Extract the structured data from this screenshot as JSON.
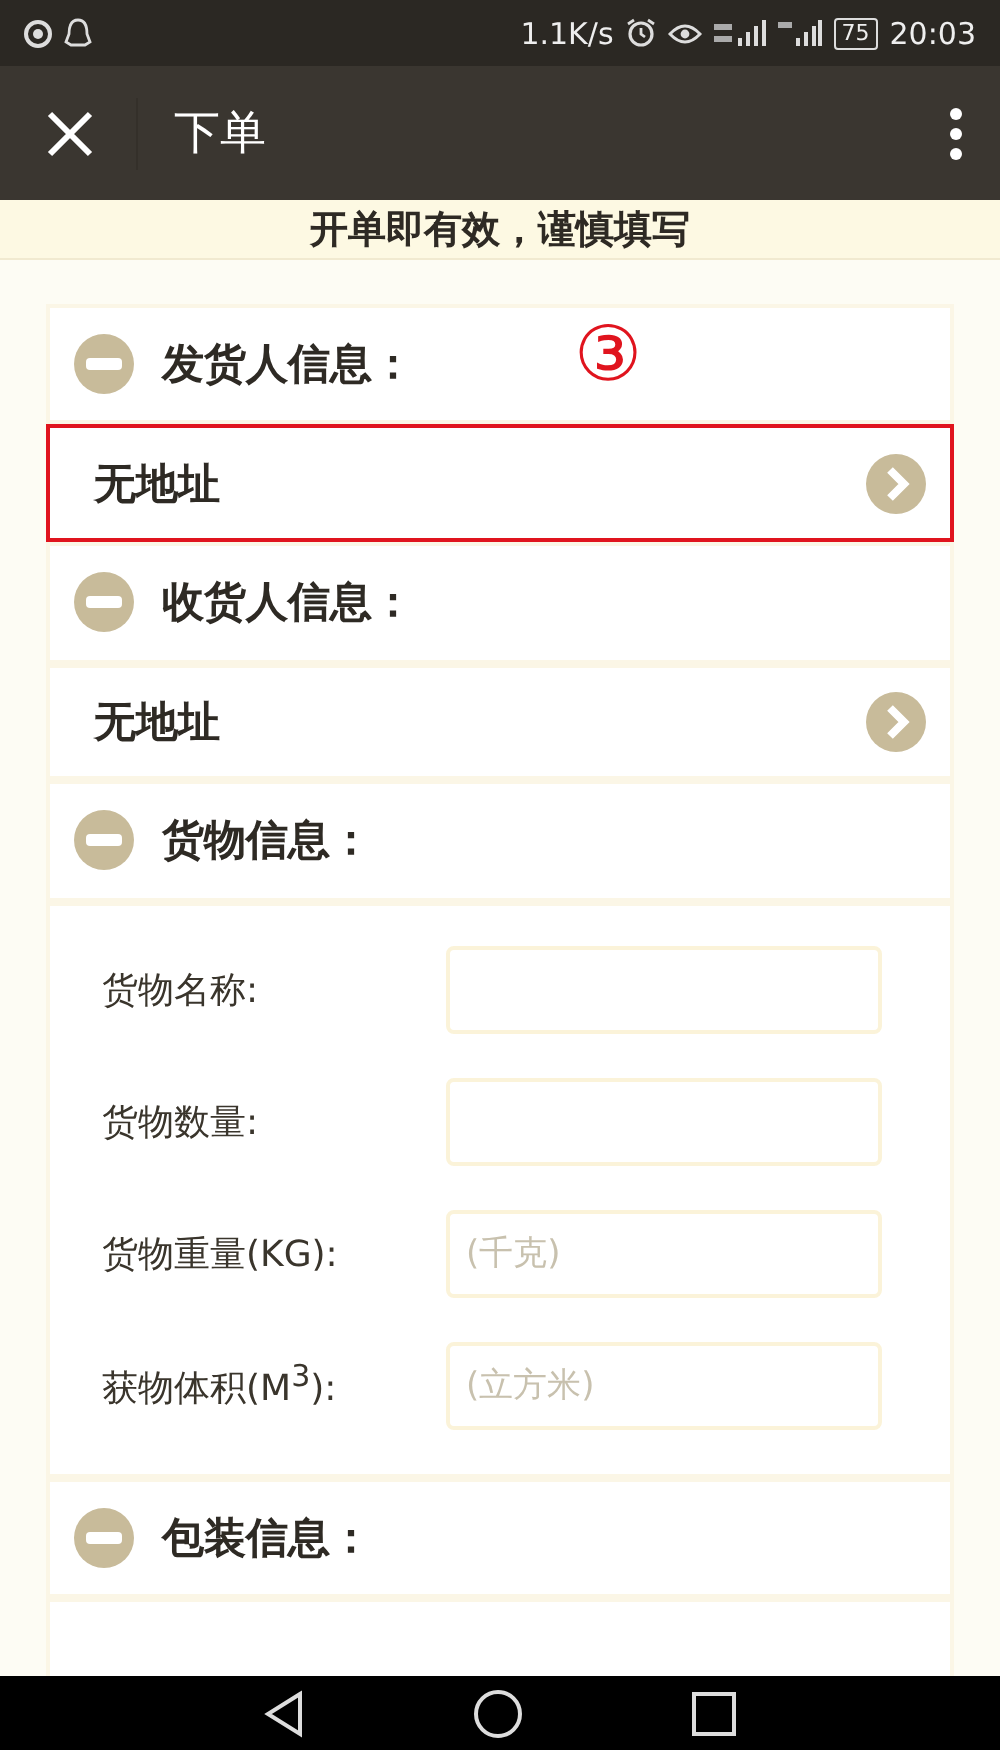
{
  "status_bar": {
    "speed": "1.1K/s",
    "battery": "75",
    "time": "20:03"
  },
  "header": {
    "title": "下单"
  },
  "notice": "开单即有效，谨慎填写",
  "annotation": "③",
  "sections": [
    {
      "kind": "address",
      "title": "发货人信息：",
      "expanded": true,
      "address": "无地址",
      "highlighted": true
    },
    {
      "kind": "address",
      "title": "收货人信息：",
      "expanded": true,
      "address": "无地址",
      "highlighted": false
    },
    {
      "kind": "fields",
      "title": "货物信息：",
      "expanded": true,
      "fields": [
        {
          "label": "货物名称:"
        },
        {
          "label": "货物数量:"
        },
        {
          "label": "货物重量(KG):",
          "placeholder": "(千克)"
        },
        {
          "label": "获物体积(M$^{3}$):",
          "placeholder": "(立方米)"
        }
      ]
    },
    {
      "kind": "partial",
      "title": "包装信息：",
      "expanded": true
    }
  ]
}
